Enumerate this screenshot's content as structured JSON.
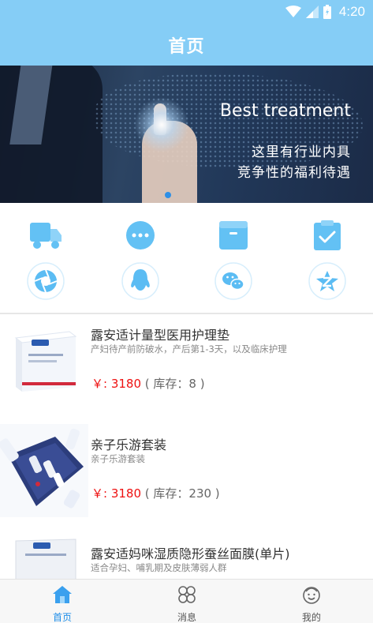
{
  "status_bar": {
    "time": "4:20"
  },
  "app_bar": {
    "title": "首页"
  },
  "banner": {
    "title": "Best treatment",
    "line1": "这里有行业内具",
    "line2": "竞争性的福利待遇"
  },
  "quick_icons": [
    {
      "icon": "truck-icon"
    },
    {
      "icon": "chat-bubble-icon"
    },
    {
      "icon": "box-icon"
    },
    {
      "icon": "clipboard-check-icon"
    },
    {
      "icon": "aperture-icon"
    },
    {
      "icon": "penguin-icon"
    },
    {
      "icon": "wechat-icon"
    },
    {
      "icon": "z-badge-icon"
    }
  ],
  "products": [
    {
      "name": "露安适计量型医用护理垫",
      "desc": "产妇待产前防破水，产后第1-3天，以及临床护理",
      "price": "￥: 3180",
      "stock": "( 库存：8 )"
    },
    {
      "name": "亲子乐游套装",
      "desc": "亲子乐游套装",
      "price": "￥: 3180",
      "stock": "( 库存：230 )"
    },
    {
      "name": "露安适妈咪湿质隐形蚕丝面膜(单片)",
      "desc": "适合孕妇、哺乳期及皮肤薄弱人群",
      "price": "",
      "stock": ""
    }
  ],
  "tab_bar": {
    "tabs": [
      {
        "label": "首页",
        "icon": "home-icon"
      },
      {
        "label": "消息",
        "icon": "clover-icon"
      },
      {
        "label": "我的",
        "icon": "face-icon"
      }
    ]
  },
  "colors": {
    "primary": "#85cdf6",
    "icon_blue": "#63c1f4",
    "active_tab": "#1f8ee8",
    "price_red": "#e11111"
  }
}
